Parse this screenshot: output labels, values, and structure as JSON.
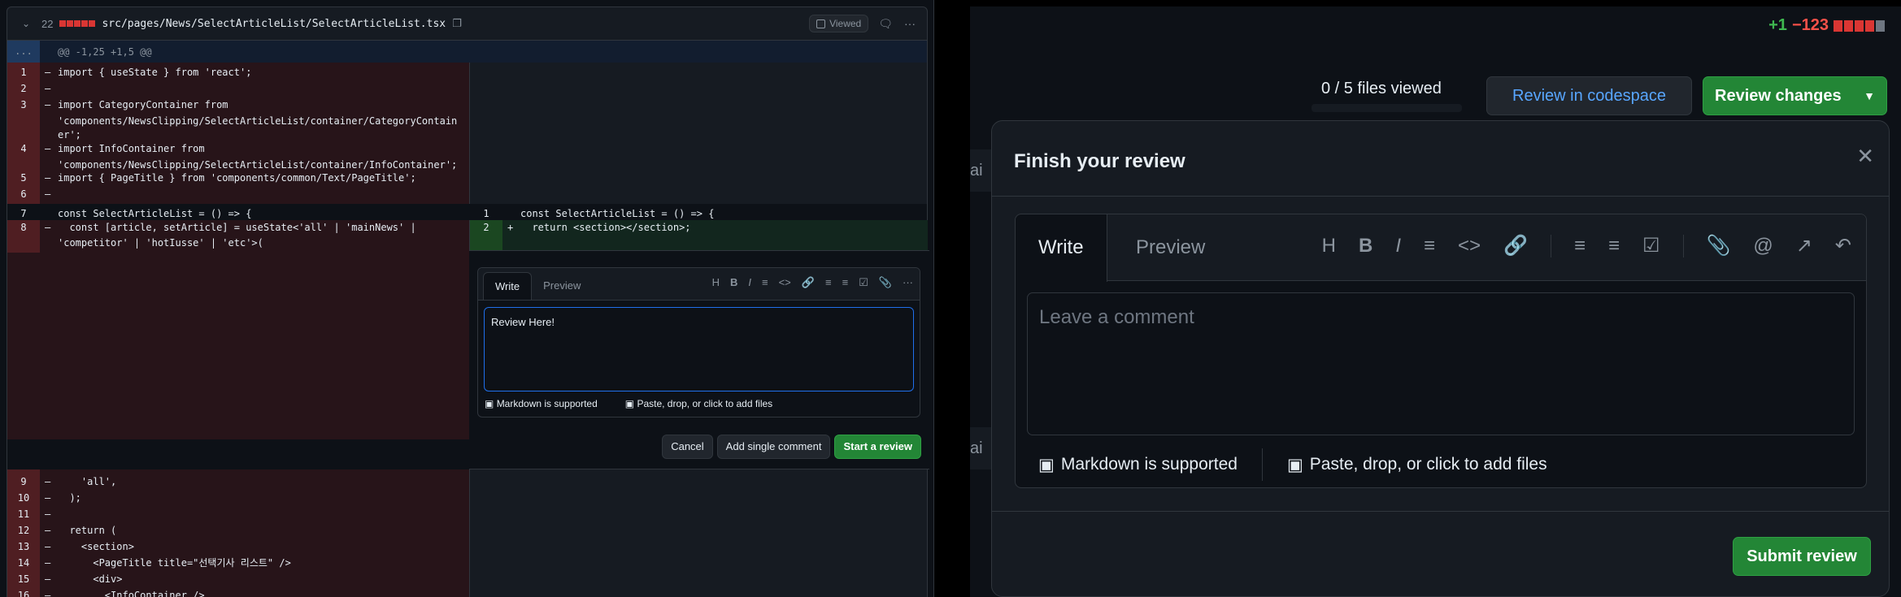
{
  "left": {
    "file_header": {
      "changed_count": "22",
      "path": "src/pages/News/SelectArticleList/SelectArticleList.tsx",
      "viewed_label": "Viewed"
    },
    "hunk_header": "@@ -1,25 +1,5 @@",
    "hunk_expand": "...",
    "old_lines": [
      {
        "n": "1",
        "m": "–",
        "code": "import { useState } from 'react';"
      },
      {
        "n": "2",
        "m": "–",
        "code": ""
      },
      {
        "n": "3",
        "m": "–",
        "code": "import CategoryContainer from"
      },
      {
        "n": "",
        "m": "",
        "code": "'components/NewsClipping/SelectArticleList/container/CategoryContain"
      },
      {
        "n": "",
        "m": "",
        "code": "er';"
      },
      {
        "n": "4",
        "m": "–",
        "code": "import InfoContainer from"
      },
      {
        "n": "",
        "m": "",
        "code": "'components/NewsClipping/SelectArticleList/container/InfoContainer';"
      },
      {
        "n": "5",
        "m": "–",
        "code": "import { PageTitle } from 'components/common/Text/PageTitle';"
      },
      {
        "n": "6",
        "m": "–",
        "code": ""
      },
      {
        "n": "7",
        "m": "",
        "code": "const SelectArticleList = () => {"
      },
      {
        "n": "8",
        "m": "–",
        "code": "  const [article, setArticle] = useState<'all' | 'mainNews' |"
      },
      {
        "n": "",
        "m": "",
        "code": "'competitor' | 'hotIusse' | 'etc'>("
      }
    ],
    "old_lines_bottom": [
      {
        "n": "9",
        "m": "–",
        "code": "    'all',"
      },
      {
        "n": "10",
        "m": "–",
        "code": "  );"
      },
      {
        "n": "11",
        "m": "–",
        "code": ""
      },
      {
        "n": "12",
        "m": "–",
        "code": "  return ("
      },
      {
        "n": "13",
        "m": "–",
        "code": "    <section>"
      },
      {
        "n": "14",
        "m": "–",
        "code": "      <PageTitle title=\"선택기사 리스트\" />"
      },
      {
        "n": "15",
        "m": "–",
        "code": "      <div>"
      },
      {
        "n": "16",
        "m": "–",
        "code": "        <InfoContainer />"
      }
    ],
    "new_lines": [
      {
        "n": "1",
        "m": "",
        "code": "const SelectArticleList = () => {"
      },
      {
        "n": "2",
        "m": "+",
        "code": "  return <section></section>;"
      }
    ],
    "inline_comment": {
      "tab_write": "Write",
      "tab_preview": "Preview",
      "text": "Review Here!",
      "markdown_note": "Markdown is supported",
      "files_note": "Paste, drop, or click to add files",
      "cancel": "Cancel",
      "add_single": "Add single comment",
      "start_review": "Start a review"
    }
  },
  "right": {
    "diffstat_add": "+1",
    "diffstat_del": "−123",
    "files_viewed": "0 / 5 files viewed",
    "codespace_label": "Review in codespace",
    "review_changes_label": "Review changes",
    "ghost_text": "ai",
    "panel": {
      "title": "Finish your review",
      "tab_write": "Write",
      "tab_preview": "Preview",
      "placeholder": "Leave a comment",
      "markdown_note": "Markdown is supported",
      "files_note": "Paste, drop, or click to add files",
      "submit": "Submit review"
    }
  },
  "colors": {
    "add": "#3fb950",
    "del": "#f85149",
    "accent": "#238636",
    "link": "#58a6ff"
  }
}
